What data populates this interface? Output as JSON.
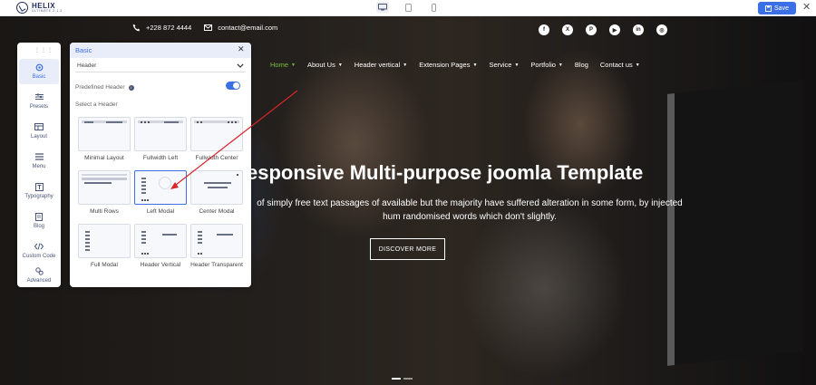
{
  "topbar": {
    "logo_name": "HELIX",
    "logo_sub": "ULTIMATE 2.1.2",
    "save_label": "Save",
    "devices": [
      "desktop-icon",
      "tablet-icon",
      "mobile-icon"
    ]
  },
  "site": {
    "phone": "+228 872 4444",
    "email": "contact@email.com",
    "socials": [
      "facebook-icon",
      "x-icon",
      "pinterest-icon",
      "youtube-icon",
      "linkedin-icon",
      "instagram-icon"
    ],
    "nav": [
      {
        "label": "Home",
        "active": true,
        "dropdown": true
      },
      {
        "label": "About Us",
        "dropdown": true
      },
      {
        "label": "Header vertical",
        "dropdown": true
      },
      {
        "label": "Extension Pages",
        "dropdown": true
      },
      {
        "label": "Service",
        "dropdown": true
      },
      {
        "label": "Portfolio",
        "dropdown": true
      },
      {
        "label": "Blog",
        "dropdown": false
      },
      {
        "label": "Contact us",
        "dropdown": true
      }
    ],
    "hero_title": "esponsive Multi-purpose joomla Template",
    "hero_text": "of simply free text passages of available but the majority have suffered alteration in some form, by injected hum randomised words which don't slightly.",
    "cta_label": "DISCOVER MORE",
    "colors": {
      "accent": "#7ac142",
      "brand": "#3b6fe6"
    }
  },
  "rail": {
    "items": [
      {
        "label": "Basic",
        "icon": "settings-icon",
        "active": true
      },
      {
        "label": "Presets",
        "icon": "sliders-icon"
      },
      {
        "label": "Layout",
        "icon": "layout-icon"
      },
      {
        "label": "Menu",
        "icon": "menu-icon"
      },
      {
        "label": "Typography",
        "icon": "typography-icon"
      },
      {
        "label": "Blog",
        "icon": "blog-icon"
      },
      {
        "label": "Custom Code",
        "icon": "code-icon"
      },
      {
        "label": "Advanced",
        "icon": "advanced-icon"
      }
    ]
  },
  "panel": {
    "title": "Basic",
    "section": "Header",
    "predefined_label": "Predefined Header",
    "predefined_on": true,
    "select_label": "Select a Header",
    "options": [
      {
        "label": "Minimal Layout"
      },
      {
        "label": "Fullwidth Left"
      },
      {
        "label": "Fullwidth Center"
      },
      {
        "label": "Multi Rows"
      },
      {
        "label": "Left Modal",
        "selected": true
      },
      {
        "label": "Center Modal"
      },
      {
        "label": "Full Modal"
      },
      {
        "label": "Header Vertical"
      },
      {
        "label": "Header Transparent"
      }
    ]
  }
}
